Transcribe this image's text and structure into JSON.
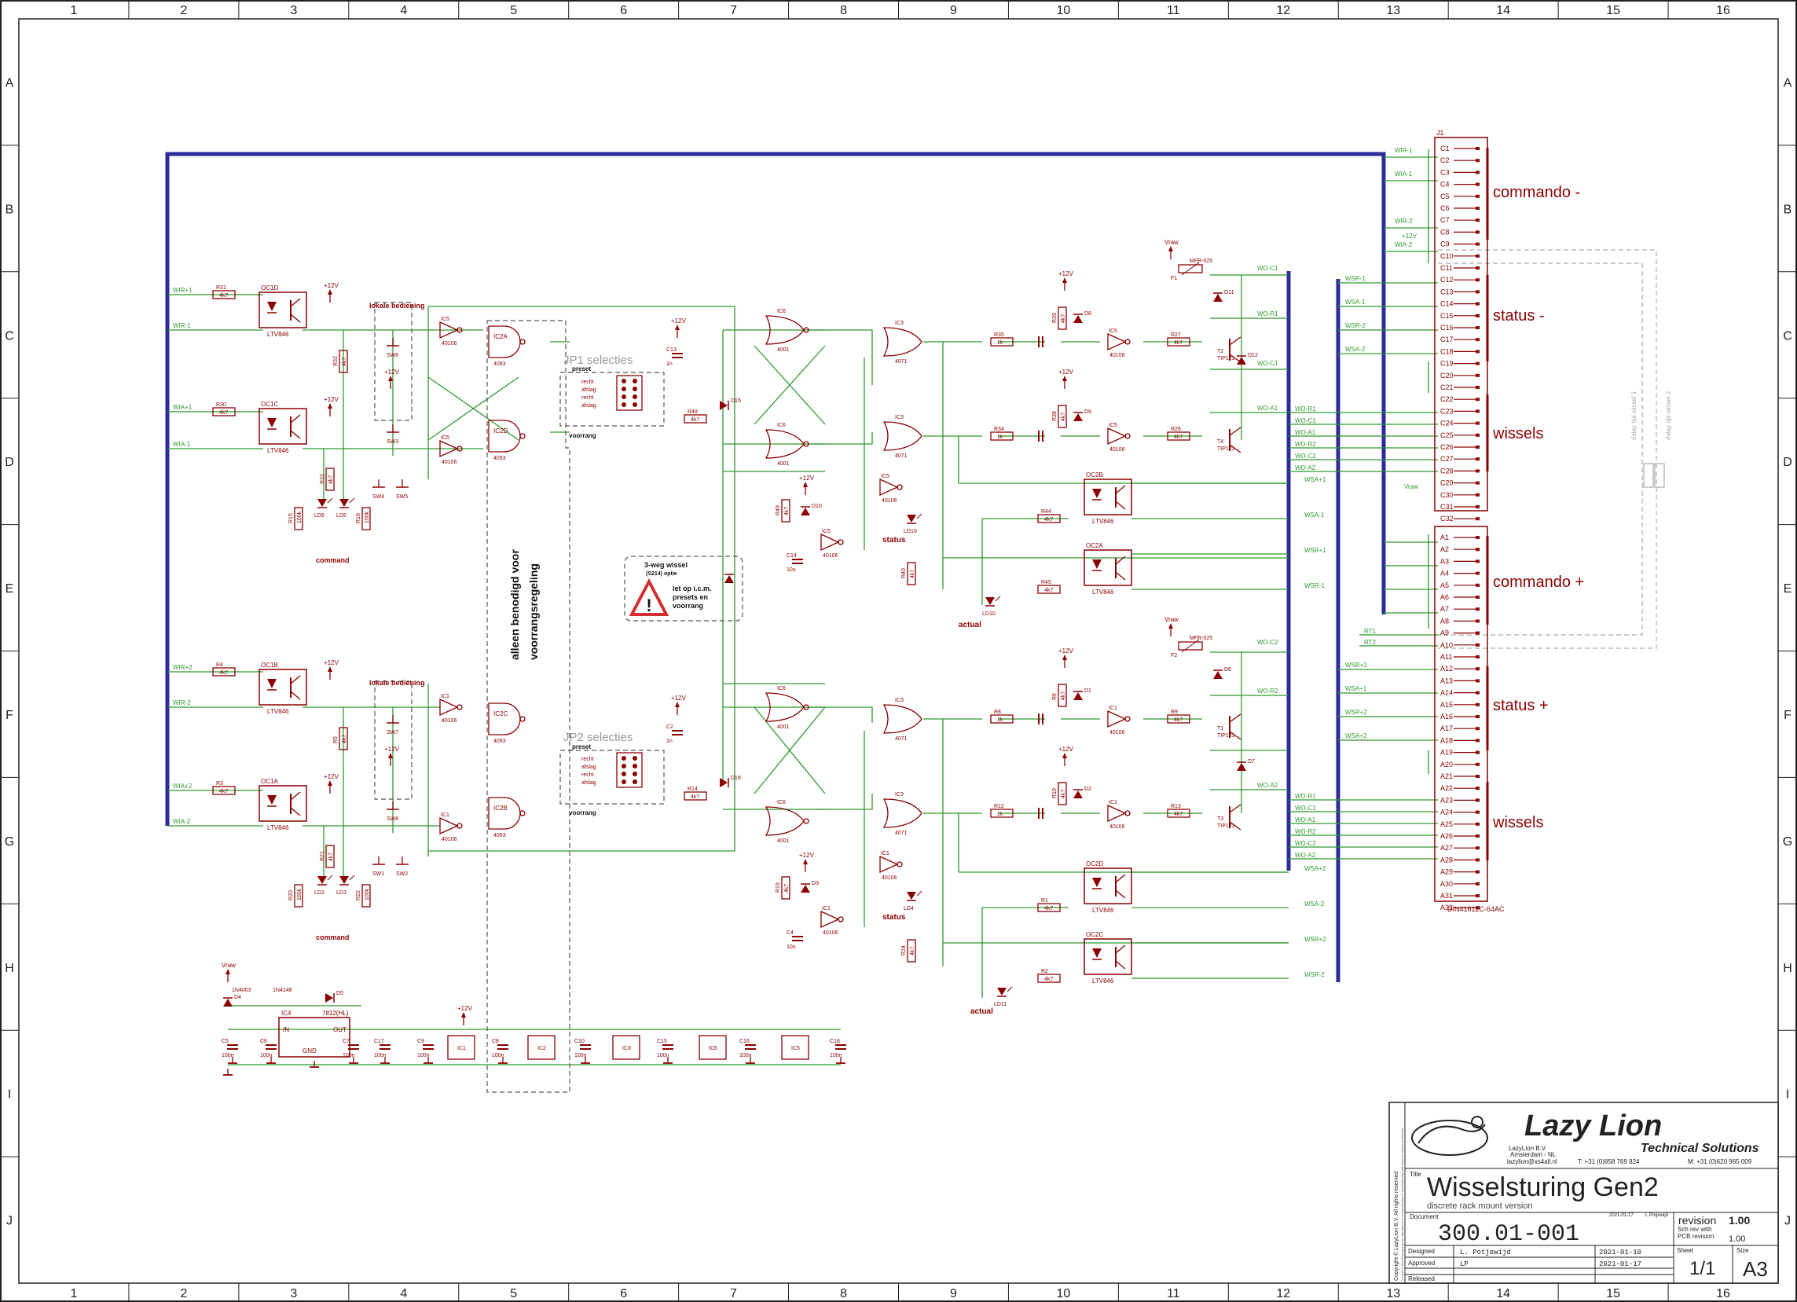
{
  "frame": {
    "columns": [
      "1",
      "2",
      "3",
      "4",
      "5",
      "6",
      "7",
      "8",
      "9",
      "10",
      "11",
      "12",
      "13",
      "14",
      "15",
      "16"
    ],
    "rows": [
      "A",
      "B",
      "C",
      "D",
      "E",
      "F",
      "G",
      "H",
      "I",
      "J"
    ]
  },
  "connector": {
    "name": "J1",
    "part": "DIN41612C-64AC",
    "c_pins": [
      "C1",
      "C2",
      "C3",
      "C4",
      "C5",
      "C6",
      "C7",
      "C8",
      "C9",
      "C10",
      "C11",
      "C12",
      "C13",
      "C14",
      "C15",
      "C16",
      "C17",
      "C18",
      "C19",
      "C20",
      "C21",
      "C22",
      "C23",
      "C24",
      "C25",
      "C26",
      "C27",
      "C28",
      "C29",
      "C30",
      "C31",
      "C32"
    ],
    "a_pins": [
      "A1",
      "A2",
      "A3",
      "A4",
      "A5",
      "A6",
      "A7",
      "A8",
      "A9",
      "A10",
      "A11",
      "A12",
      "A13",
      "A14",
      "A15",
      "A16",
      "A17",
      "A18",
      "A19",
      "A20",
      "A21",
      "A22",
      "A23",
      "A24",
      "A25",
      "A26",
      "A27",
      "A28",
      "A29",
      "A30",
      "A31",
      "A32"
    ],
    "groups": [
      "commando -",
      "status -",
      "wissels",
      "commando +",
      "status +",
      "wissels"
    ],
    "delay_1": "delay tijd wissel 1",
    "delay_2": "delay tijd wissel 2"
  },
  "nets": {
    "c_side": [
      "WIR-1",
      "WIA-1",
      "WIR-2",
      "WIA-2",
      "WSR-1",
      "WSA-1",
      "WSR-2",
      "WSA-2",
      "WO-R1",
      "WO-C1",
      "WO-A1",
      "WO-R2",
      "WO-C2",
      "WO-A2",
      "WSA+1",
      "WSA-1",
      "WSR+1",
      "WSR-1",
      "WO-C1",
      "WO-R1",
      "WO-C1",
      "WO-A1",
      "+12V",
      "Vraw"
    ],
    "a_side": [
      "WIR+1",
      "WIA+1",
      "WIR+2",
      "WIA+2",
      "RT1",
      "RT2",
      "WSR+1",
      "WSA+1",
      "WSR+2",
      "WSA+2",
      "WO-R1",
      "WO-C1",
      "WO-A1",
      "WO-R2",
      "WO-C2",
      "WO-A2",
      "WSA+2",
      "WSA-2",
      "WSR+2",
      "WSR-2",
      "WO-C2",
      "WO-R2",
      "WO-A2"
    ]
  },
  "labels": {
    "lokale_bediening": "lokale bediening",
    "recht": "recht",
    "afslag": "afslag",
    "command": "command",
    "status": "status",
    "actual": "actual",
    "jp1": "JP1 selecties",
    "jp2": "JP2 selecties",
    "preset": "preset",
    "voorrang": "voorrang",
    "jp_rows": [
      "recht",
      "afslag",
      "recht",
      "afslag"
    ],
    "alleen": "alleen benodigd voor",
    "voorrangsregeling": "voorrangsregeling",
    "warn1": "3-weg wissel",
    "warn2": "(S214) optie",
    "warn3": "let op i.c.m.",
    "warn4": "presets en",
    "warn5": "voorrang"
  },
  "parts": {
    "opto_top": [
      "OC1D",
      "OC1C"
    ],
    "opto_bot": [
      "OC1B",
      "OC1A"
    ],
    "opto_out_top": [
      "OC2B",
      "OC2A"
    ],
    "opto_out_bot": [
      "OC2D",
      "OC2C"
    ],
    "ltv": "LTV846",
    "r4k7": "4k7",
    "r1k": "1k",
    "r1k_b": "1k",
    "r100k": "100k",
    "cap_1n": "1n",
    "cap_1u": "1u",
    "cap_100n": "100n",
    "cap_10u": "10u",
    "v25": "25V",
    "v35": "35V",
    "diode_4148": "1N4148",
    "diode_4003": "1N4003",
    "transistor": "TIP121",
    "fuse": "MFR-025",
    "nand": "4093",
    "inv": "40106",
    "nor": "4001",
    "or": "4071",
    "reg": "7812(HL)",
    "reg_name": "IC4",
    "reg_in": "IN",
    "reg_out": "OUT",
    "reg_gnd": "GND",
    "p12": "+12V",
    "vraw": "Vraw",
    "switches_top": [
      "SW4",
      "SW5"
    ],
    "switches_bot": [
      "SW1",
      "SW2"
    ],
    "res_top": [
      "R31",
      "R30",
      "R32",
      "R33",
      "R15",
      "R16",
      "R35",
      "R34",
      "R44",
      "R45",
      "R27",
      "R26",
      "R39",
      "R38",
      "R40",
      "R48",
      "R49",
      "R18"
    ],
    "res_bot": [
      "R4",
      "R3",
      "R1",
      "R2",
      "R20",
      "R22",
      "R8",
      "R12",
      "R9",
      "R13",
      "R6",
      "R10",
      "R19",
      "R24",
      "R14",
      "R11"
    ],
    "ics": [
      "IC1",
      "IC2",
      "IC3",
      "IC5",
      "IC6",
      "IC4"
    ],
    "leds": [
      "LD6",
      "LD5",
      "LD10",
      "LD9",
      "LD8",
      "LD4",
      "LD7",
      "LD3"
    ],
    "decoupling": [
      "C5",
      "C6",
      "C7",
      "C17",
      "C9",
      "C8",
      "C10",
      "C15",
      "C16",
      "C18",
      "C13",
      "C2",
      "C14",
      "C4",
      "C1",
      "C3",
      "C11",
      "C12"
    ]
  },
  "title_block": {
    "company": "Lazy Lion",
    "subtitle": "Technical Solutions",
    "address_1": "LazyLion B.V.",
    "address_2": "Amsterdam - NL",
    "email": "lazylion@xs4all.nl",
    "tel": "T: +31 (0)858 769 824",
    "mobile": "M: +31 (0)620 965 009",
    "title_label": "Title",
    "title": "Wisselsturing Gen2",
    "description": "discrete rack mount version",
    "document_label": "Document",
    "document": "300.01-001",
    "revision_label": "revision",
    "revision": "1.00",
    "sch_label": "Sch rev with",
    "pcb_label": "PCB revision",
    "pcb_rev": "1.00",
    "rev_date": "2021-01-17",
    "rev_by": "L.Potjewijd",
    "designed_label": "Designed",
    "designed_by": "L. Potjewijd",
    "designed_date": "2021-01-10",
    "approved_label": "Approved",
    "approved_by": "LP",
    "approved_date": "2021-01-17",
    "released_label": "Released",
    "sheet_label": "Sheet",
    "sheet": "1/1",
    "size_label": "Size",
    "size": "A3",
    "copyright": "Copyright © LazyLion B.V. All rights reserved",
    "copyright2": "No part of this drawing may be reproduced or communicated to any third party without prior written permission"
  },
  "colors": {
    "wire": "#2e9a2e",
    "part": "#8b0000",
    "bus": "#2b2b9a",
    "frame": "#222222",
    "dashed": "#aaaaaa"
  }
}
